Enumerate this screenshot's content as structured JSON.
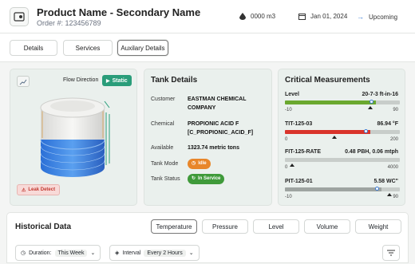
{
  "header": {
    "product_name": "Product Name - Secondary Name",
    "order": "Order #: 123456789",
    "volume": "0000 m3",
    "date": "Jan 01, 2024",
    "status": "Upcoming"
  },
  "tabs": [
    "Details",
    "Services",
    "Auxilary Details"
  ],
  "left": {
    "flow_label": "Flow Direction",
    "flow_state": "Static",
    "leak": "Leak Detect"
  },
  "tank": {
    "title": "Tank Details",
    "rows": [
      {
        "k": "Customer",
        "v": "EASTMAN CHEMICAL COMPANY"
      },
      {
        "k": "Chemical",
        "v": "PROPIONIC ACID F [C_PROPIONIC_ACID_F]"
      },
      {
        "k": "Available",
        "v": "1323.74 metric tons"
      },
      {
        "k": "Tank Mode",
        "v": "Idle"
      },
      {
        "k": "Tank Status",
        "v": "In Service"
      }
    ]
  },
  "critical": {
    "title": "Critical Measurements",
    "items": [
      {
        "label": "Level",
        "value": "20-7-3 ft-in-16",
        "min": "-10",
        "max": "90",
        "color": "#6aa82f",
        "level": 0.79,
        "marker": 0.74
      },
      {
        "label": "TIT-125-03",
        "value": "86.94 °F",
        "min": "0",
        "max": "200",
        "color": "#d9342b",
        "level": 0.74,
        "marker": 0.43
      },
      {
        "label": "FIT-125-RATE",
        "value": "0.48 PBH, 0.06 mtph",
        "min": "0",
        "max": "4000",
        "color": "#c8cdca",
        "level": 0.0,
        "marker": 0.06
      },
      {
        "label": "PIT-125-01",
        "value": "5.58 WC\"",
        "min": "-10",
        "max": "90",
        "color": "#9ea4a1",
        "level": 0.84,
        "marker": 0.91
      }
    ]
  },
  "history": {
    "title": "Historical Data",
    "buttons": [
      "Temperature",
      "Pressure",
      "Level",
      "Volume",
      "Weight"
    ],
    "duration_label": "Duration:",
    "duration": "This Week",
    "interval_label": "Interval",
    "interval": "Every 2 Hours"
  }
}
